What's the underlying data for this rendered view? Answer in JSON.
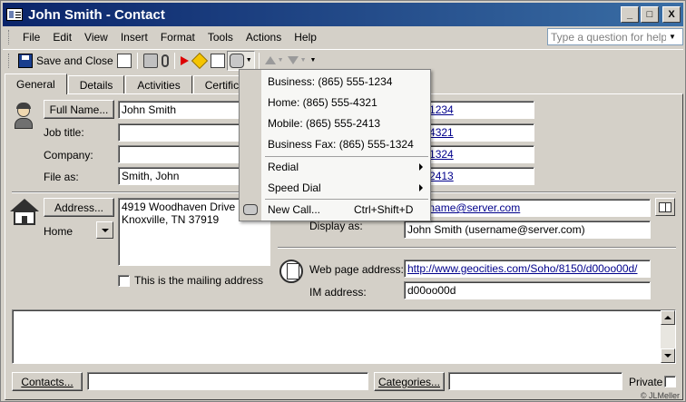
{
  "window": {
    "title": "John Smith - Contact",
    "controls": {
      "minimize": "_",
      "maximize": "□",
      "close": "X"
    }
  },
  "menubar": {
    "items": [
      "File",
      "Edit",
      "View",
      "Insert",
      "Format",
      "Tools",
      "Actions",
      "Help"
    ],
    "help_placeholder": "Type a question for help"
  },
  "toolbar": {
    "save_close_label": "Save and Close",
    "icons": [
      "save-icon",
      "new-item-icon",
      "print-icon",
      "attach-icon",
      "flag-icon",
      "categories-icon",
      "contact-card-icon",
      "dial-icon",
      "previous-item-icon",
      "next-item-icon"
    ]
  },
  "tabs": [
    "General",
    "Details",
    "Activities",
    "Certificates"
  ],
  "general": {
    "full_name_button": "Full Name...",
    "full_name_value": "John Smith",
    "job_title_label": "Job title:",
    "job_title_value": "",
    "company_label": "Company:",
    "company_value": "",
    "file_as_label": "File as:",
    "file_as_value": "Smith, John",
    "phones": [
      "555-1234",
      "555-4321",
      "555-1324",
      "555-2413"
    ],
    "address_button": "Address...",
    "address_type": "Home",
    "address_lines": [
      "4919 Woodhaven Drive",
      "Knoxville, TN  37919"
    ],
    "mailing_label": "This is the mailing address",
    "email_value": "username@server.com",
    "display_as_label": "Display as:",
    "display_as_value": "John Smith (username@server.com)",
    "web_label": "Web page address:",
    "web_value": "http://www.geocities.com/Soho/8150/d00oo00d/",
    "im_label": "IM address:",
    "im_value": "d00oo00d",
    "contacts_button": "Contacts...",
    "categories_button": "Categories...",
    "private_label": "Private",
    "credit": "© JLMeller"
  },
  "dial_menu": {
    "items": [
      {
        "label": "Business: (865) 555-1234"
      },
      {
        "label": "Home: (865) 555-4321"
      },
      {
        "label": "Mobile: (865) 555-2413"
      },
      {
        "label": "Business Fax: (865) 555-1324"
      },
      {
        "label": "Redial"
      },
      {
        "label": "Speed Dial"
      },
      {
        "label": "New Call...",
        "shortcut": "Ctrl+Shift+D"
      }
    ]
  },
  "colors": {
    "title_gradient_start": "#0a246a",
    "title_gradient_end": "#3a6ea5",
    "face": "#d4d0c8",
    "link": "#00008b"
  }
}
